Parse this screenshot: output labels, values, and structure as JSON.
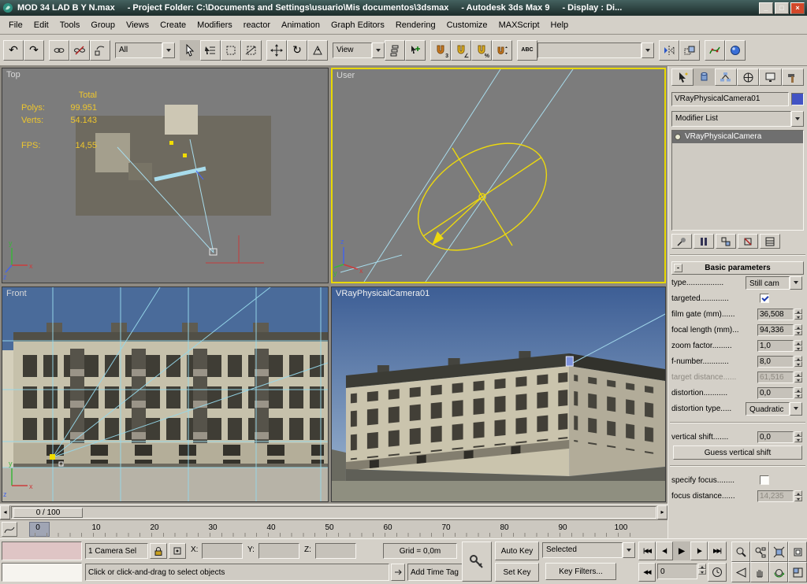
{
  "window": {
    "title_parts": [
      "MOD 34 LAD B Y N.max",
      "- Project Folder: C:\\Documents and Settings\\usuario\\Mis documentos\\3dsmax",
      "- Autodesk 3ds Max 9",
      "- Display : Di..."
    ],
    "minimize": "_",
    "maximize": "□",
    "close": "×"
  },
  "menu": {
    "items": [
      "File",
      "Edit",
      "Tools",
      "Group",
      "Views",
      "Create",
      "Modifiers",
      "reactor",
      "Animation",
      "Graph Editors",
      "Rendering",
      "Customize",
      "MAXScript",
      "Help"
    ]
  },
  "toolbar": {
    "selection_filter": "All",
    "coord_system": "View"
  },
  "icons": {
    "undo": "↶",
    "redo": "↷",
    "rotate": "↻",
    "abc": "ABC",
    "snap3": "3",
    "snap_angle": "∠",
    "snap_percent": "%",
    "left": "◂",
    "right": "▸",
    "go_start": "|◀◀",
    "prev": "◀|",
    "play": "▶",
    "next": "|▶",
    "go_end": "▶▶|",
    "key_step": "◀◀"
  },
  "axis": {
    "x": "x",
    "y": "y",
    "z": "z"
  },
  "viewports": {
    "top": {
      "label": "Top",
      "stats": {
        "total_label": "Total",
        "polys_label": "Polys:",
        "polys": "99.951",
        "verts_label": "Verts:",
        "verts": "54.143",
        "fps_label": "FPS:",
        "fps": "14,55"
      }
    },
    "user": {
      "label": "User"
    },
    "front": {
      "label": "Front"
    },
    "camera": {
      "label": "VRayPhysicalCamera01"
    }
  },
  "command_panel": {
    "object_name": "VRayPhysicalCamera01",
    "modifier_list_label": "Modifier List",
    "stack": [
      "VRayPhysicalCamera"
    ],
    "rollout": {
      "title": "Basic parameters",
      "collapse": "-",
      "guess_vertical": "Guess vertical shift",
      "params": {
        "type": {
          "label": "type.................",
          "value": "Still cam"
        },
        "targeted": {
          "label": "targeted.............",
          "checked": true
        },
        "film_gate": {
          "label": "film gate (mm)......",
          "value": "36,508"
        },
        "focal_length": {
          "label": "focal length (mm)...",
          "value": "94,336"
        },
        "zoom_factor": {
          "label": "zoom factor.........",
          "value": "1,0"
        },
        "f_number": {
          "label": "f-number............",
          "value": "8,0"
        },
        "target_distance": {
          "label": "target distance......",
          "value": "61,516"
        },
        "distortion": {
          "label": "distortion...........",
          "value": "0,0"
        },
        "distortion_type": {
          "label": "distortion type.....",
          "value": "Quadratic"
        },
        "vertical_shift": {
          "label": "vertical shift.......",
          "value": "0,0"
        },
        "specify_focus": {
          "label": "specify focus........",
          "checked": false
        },
        "focus_distance": {
          "label": "focus distance......",
          "value": "14,235"
        }
      }
    }
  },
  "timeline": {
    "slider_label": "0 / 100",
    "ticks": [
      "0",
      "10",
      "20",
      "30",
      "40",
      "50",
      "60",
      "70",
      "80",
      "90",
      "100"
    ]
  },
  "status_bar": {
    "selection": "1 Camera Sel",
    "x_label": "X:",
    "y_label": "Y:",
    "z_label": "Z:",
    "grid": "Grid = 0,0m",
    "prompt": "Click or click-and-drag to select objects",
    "add_time_tag": "Add Time Tag",
    "auto_key": "Auto Key",
    "set_key": "Set Key",
    "key_mode": "Selected",
    "key_filters": "Key Filters...",
    "frame": "0"
  },
  "colors": {
    "active_viewport_border": "#e8d800",
    "sky": "#47689c",
    "stats_text": "#eec62e",
    "object_swatch": "#4253c4"
  }
}
